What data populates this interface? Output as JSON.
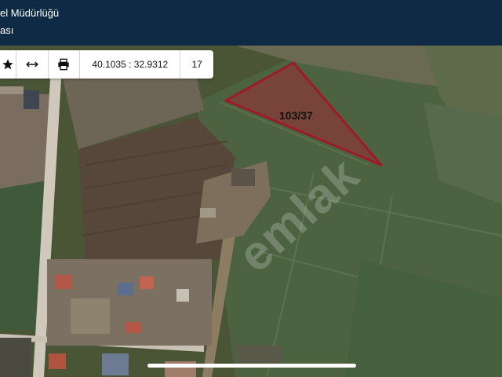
{
  "header": {
    "title_line1": "el Müdürlüğü",
    "title_line2": "ası"
  },
  "toolbar": {
    "star_icon": "star-icon",
    "measure_icon": "measure-icon",
    "print_icon": "print-icon",
    "coordinates": "40.1035 : 32.9312",
    "zoom_level": "17"
  },
  "map": {
    "parcel_label": "103/37",
    "parcel_color": "#b0202e",
    "watermark": "emlak"
  }
}
